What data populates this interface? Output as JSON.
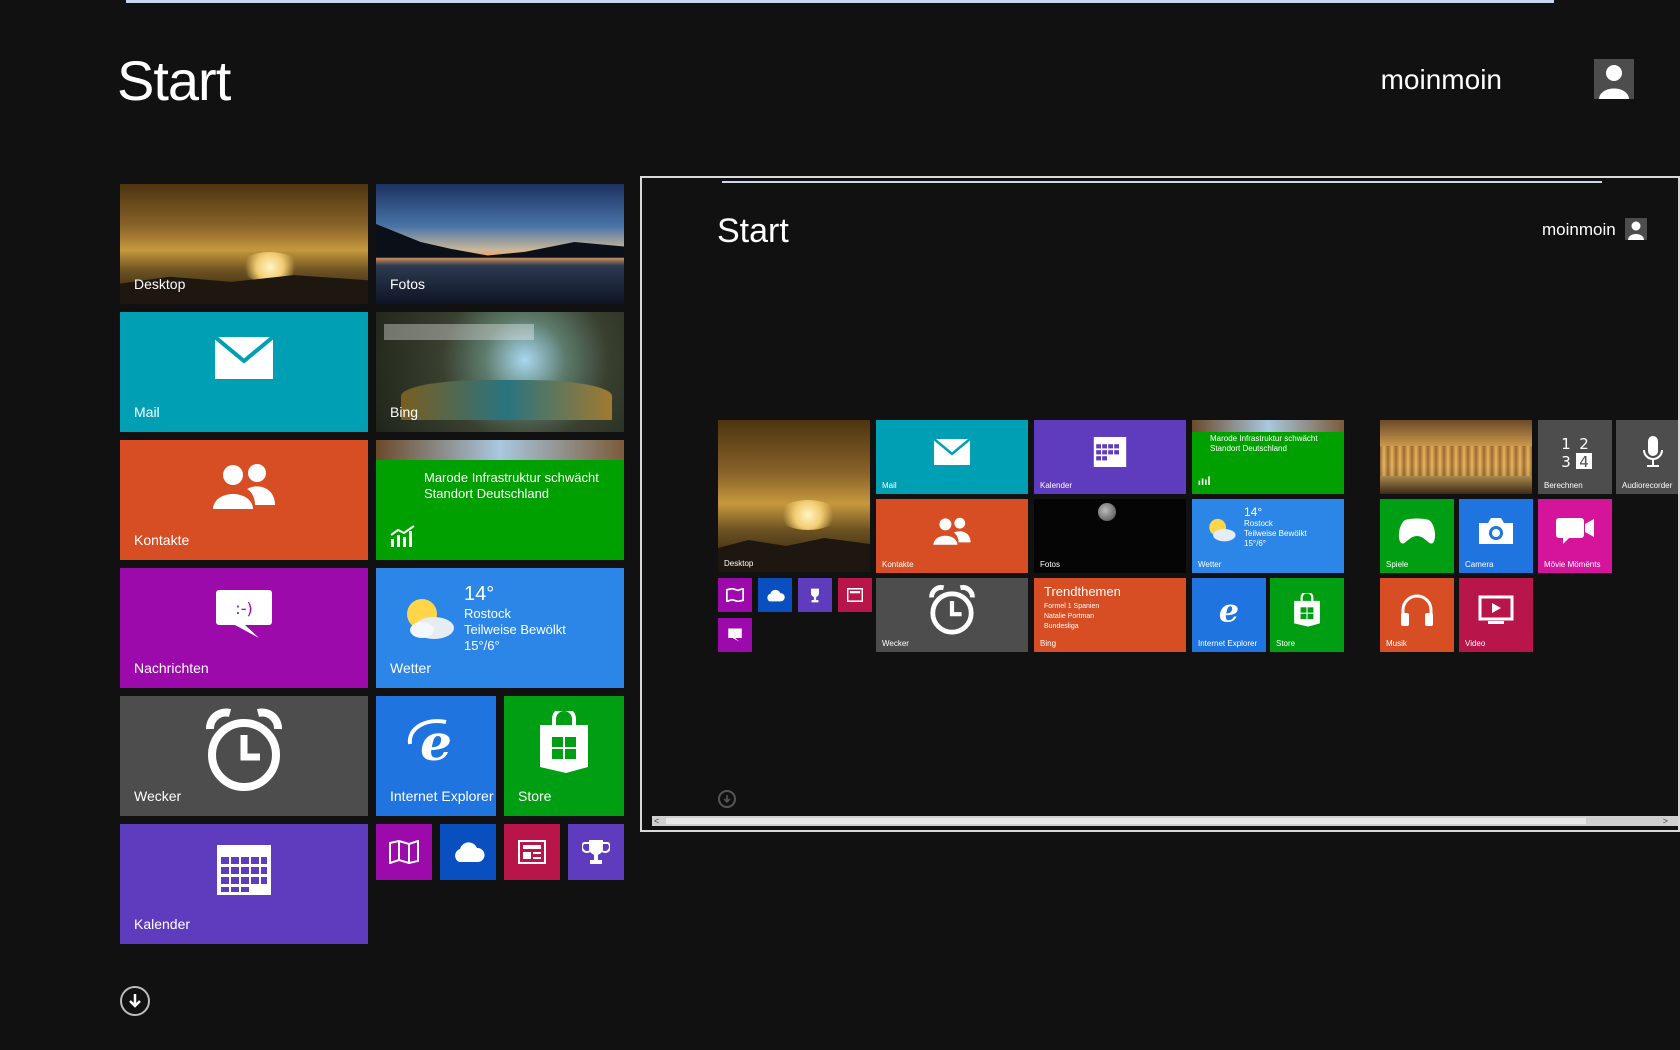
{
  "header": {
    "title": "Start",
    "user": "moinmoin"
  },
  "tiles": {
    "desktop": "Desktop",
    "fotos": "Fotos",
    "mail": "Mail",
    "bing": "Bing",
    "kontakte": "Kontakte",
    "finance_news": "Marode Infrastruktur schwächt Standort Deutschland",
    "nachrichten": "Nachrichten",
    "wetter": {
      "label": "Wetter",
      "temp": "14°",
      "city": "Rostock",
      "condition": "Teilweise Bewölkt",
      "range": "15°/6°"
    },
    "wecker": "Wecker",
    "ie": "Internet Explorer",
    "store": "Store",
    "kalender": "Kalender"
  },
  "preview": {
    "title": "Start",
    "user": "moinmoin",
    "tiles": {
      "desktop": "Desktop",
      "mail": "Mail",
      "kalender": "Kalender",
      "finance_news": "Marode Infrastruktur schwächt Standort Deutschland",
      "kontakte": "Kontakte",
      "fotos": "Fotos",
      "wetter": {
        "label": "Wetter",
        "temp": "14°",
        "city": "Rostock",
        "condition": "Teilweise Bewölkt",
        "range": "15°/6°"
      },
      "wecker": "Wecker",
      "trend": {
        "title": "Trendthemen",
        "line1": "Formel 1 Spanien",
        "line2": "Natalie Portman",
        "line3": "Bundesliga",
        "label": "Bing"
      },
      "ie": "Internet Explorer",
      "store": "Store",
      "berechnen": "Berechnen",
      "audiorecorder": "Audiorecorder",
      "spiele": "Spiele",
      "camera": "Camera",
      "movie_moments": "Mövie Mömënts",
      "musik": "Musik",
      "video": "Video"
    }
  },
  "colors": {
    "background": "#111111",
    "mail": "#009fb4",
    "kontakte": "#d74e24",
    "nachrichten": "#9c0aac",
    "wecker": "#4d4d4d",
    "kalender": "#5f3bbd",
    "finance": "#00a000",
    "weather": "#2b86e8",
    "ie": "#1f74e0",
    "store": "#009e12"
  }
}
